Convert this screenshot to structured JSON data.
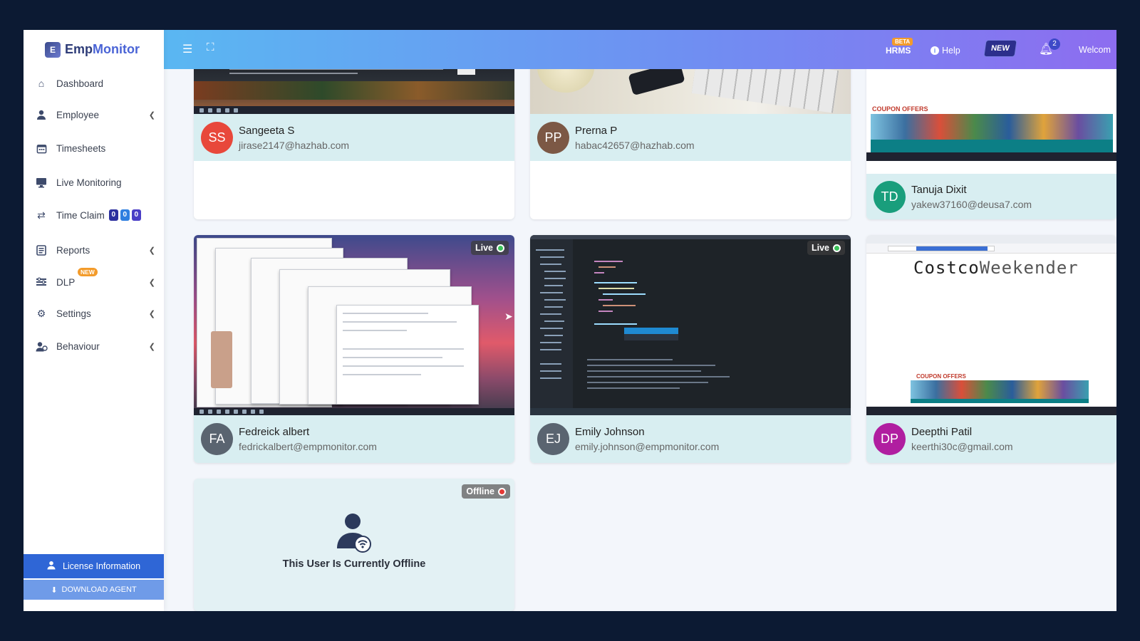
{
  "brand": {
    "name_part1": "Emp",
    "name_part2": "Monitor"
  },
  "header": {
    "hrms_label": "HRMS",
    "beta_label": "BETA",
    "help_label": "Help",
    "new_label": "NEW",
    "notification_count": "2",
    "welcome_text": "Welcom"
  },
  "sidebar": {
    "items": [
      {
        "label": "Dashboard",
        "icon": "home-icon"
      },
      {
        "label": "Employee",
        "icon": "user-icon"
      },
      {
        "label": "Timesheets",
        "icon": "calendar-icon"
      },
      {
        "label": "Live Monitoring",
        "icon": "monitor-icon"
      },
      {
        "label": "Time Claim",
        "icon": "swap-icon"
      },
      {
        "label": "Reports",
        "icon": "report-icon"
      },
      {
        "label": "DLP",
        "icon": "dlp-icon"
      },
      {
        "label": "Settings",
        "icon": "gear-icon"
      },
      {
        "label": "Behaviour",
        "icon": "behaviour-icon"
      }
    ],
    "time_claim_badges": [
      "0",
      "0",
      "0"
    ],
    "time_claim_colors": [
      "#2b2f9e",
      "#2f7fe0",
      "#4a3ec6"
    ],
    "dlp_new_label": "NEW",
    "license_label": "License Information",
    "download_label": "DOWNLOAD AGENT"
  },
  "employees": [
    {
      "initials": "SS",
      "name": "Sangeeta S",
      "email": "jirase2147@hazhab.com",
      "avatar_color": "#e8483b"
    },
    {
      "initials": "PP",
      "name": "Prerna P",
      "email": "habac42657@hazhab.com",
      "avatar_color": "#7c5845"
    },
    {
      "initials": "TD",
      "name": "Tanuja Dixit",
      "email": "yakew37160@deusa7.com",
      "avatar_color": "#199e7c"
    },
    {
      "initials": "FA",
      "name": "Fedreick albert",
      "email": "fedrickalbert@empmonitor.com",
      "avatar_color": "#5a6470",
      "status": "Live"
    },
    {
      "initials": "EJ",
      "name": "Emily Johnson",
      "email": "emily.johnson@empmonitor.com",
      "avatar_color": "#5a6470",
      "status": "Live"
    },
    {
      "initials": "DP",
      "name": "Deepthi Patil",
      "email": "keerthi30c@gmail.com",
      "avatar_color": "#b01ea0"
    }
  ],
  "screens": {
    "coupon_label": "COUPON OFFERS",
    "costco_part1": "Costco",
    "costco_part2": "Weekender"
  },
  "offline": {
    "badge": "Offline",
    "message": "This User Is Currently Offline"
  },
  "colors": {
    "live": "#3cc25a",
    "offline": "#e53935",
    "header_start": "#5ab7f2",
    "header_end": "#8d6df0",
    "license_bg": "#2f66d6"
  }
}
